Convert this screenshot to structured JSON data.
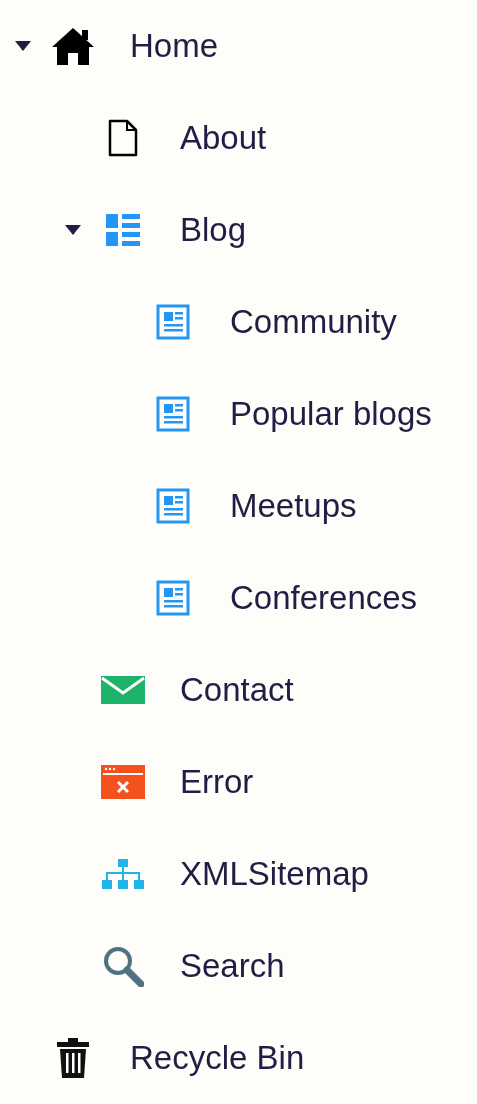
{
  "tree": [
    {
      "label": "Home",
      "kind": "home",
      "expanded": true,
      "children": [
        {
          "label": "About",
          "kind": "page"
        },
        {
          "label": "Blog",
          "kind": "list",
          "expanded": true,
          "children": [
            {
              "label": "Community",
              "kind": "article"
            },
            {
              "label": "Popular blogs",
              "kind": "article"
            },
            {
              "label": "Meetups",
              "kind": "article"
            },
            {
              "label": "Conferences",
              "kind": "article"
            }
          ]
        },
        {
          "label": "Contact",
          "kind": "mail"
        },
        {
          "label": "Error",
          "kind": "error"
        },
        {
          "label": "XMLSitemap",
          "kind": "sitemap"
        },
        {
          "label": "Search",
          "kind": "search"
        }
      ]
    },
    {
      "label": "Recycle Bin",
      "kind": "trash"
    }
  ]
}
